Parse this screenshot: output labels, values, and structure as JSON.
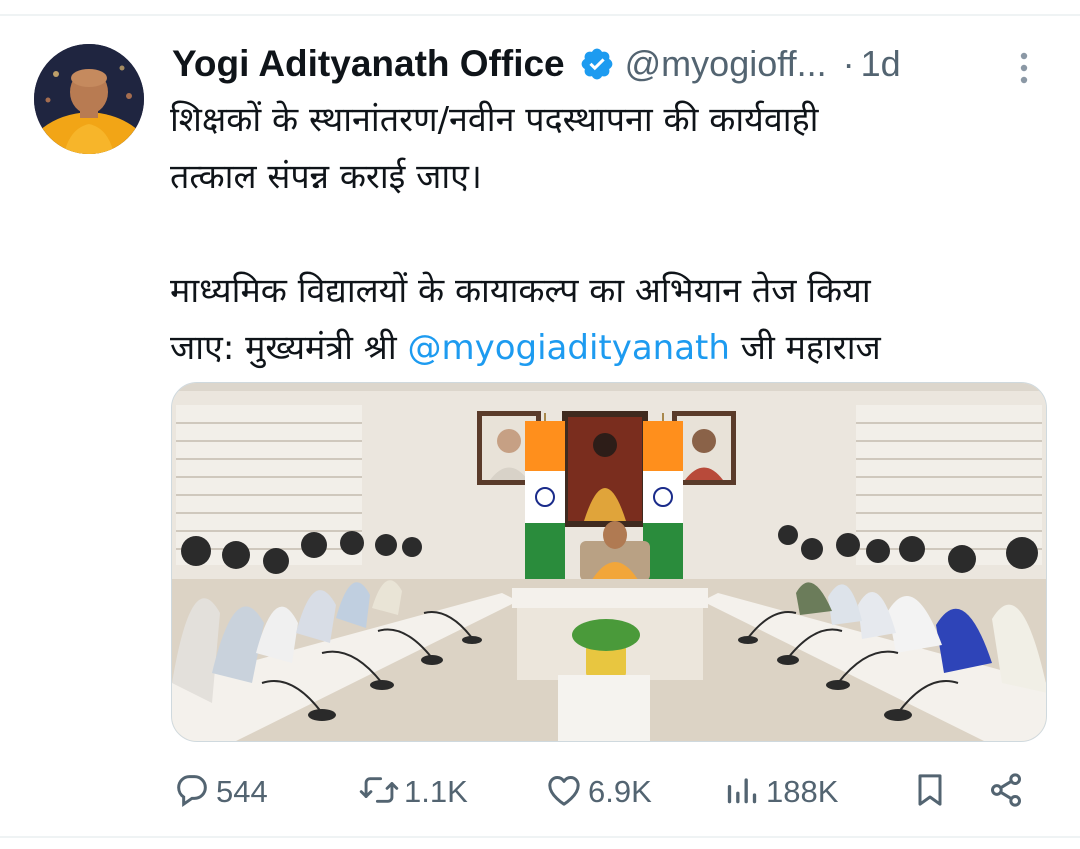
{
  "tweet": {
    "display_name": "Yogi Adityanath Office",
    "handle": "@myogioff...",
    "separator": "·",
    "time": "1d",
    "text_line_1": "शिक्षकों के स्थानांतरण/नवीन पदस्थापना की कार्यवाही",
    "text_line_2": "तत्काल संपन्न कराई जाए।",
    "text_line_3": "माध्यमिक विद्यालयों के कायाकल्प का अभियान तेज किया",
    "text_line_4_prefix": "जाए: मुख्यमंत्री श्री ",
    "mention": "@myogiadityanath",
    "text_line_4_suffix": " जी महाराज"
  },
  "actions": {
    "reply_count": "544",
    "retweet_count": "1.1K",
    "like_count": "6.9K",
    "view_count": "188K"
  },
  "icons": [
    "verified-badge-icon",
    "more-options-icon",
    "reply-icon",
    "retweet-icon",
    "like-icon",
    "views-icon",
    "bookmark-icon",
    "share-icon"
  ],
  "colors": {
    "text_primary": "#0f1419",
    "text_secondary": "#536471",
    "link": "#1d9bf0",
    "verified": "#1d9bf0"
  }
}
